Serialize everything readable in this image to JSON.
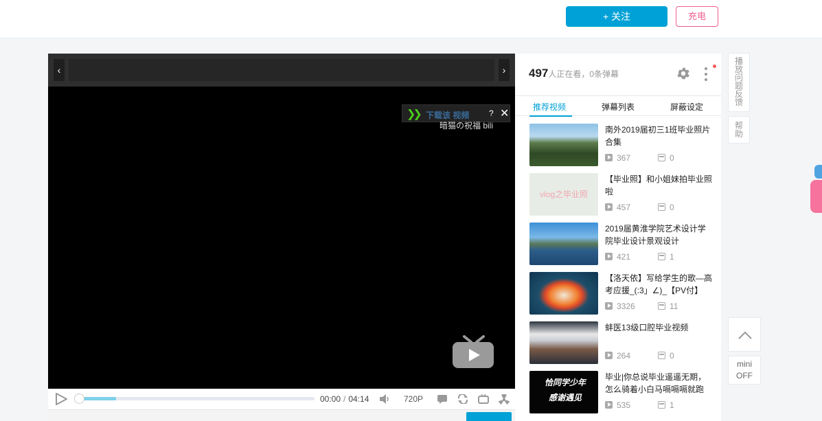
{
  "header": {
    "follow_label": "+ 关注",
    "charge_label": "充电"
  },
  "player": {
    "download_tip": "下载该 视频",
    "download_tip_help": "?",
    "download_tip_close": "✕",
    "watermark": "暗猫の祝福 bili",
    "current_time": "00:00",
    "time_separator": "/",
    "duration": "04:14",
    "quality": "720P",
    "progress_buffered": 0.16
  },
  "sidebar": {
    "viewer_count": "497",
    "viewer_text": "人正在看，0条弹幕",
    "tabs": [
      {
        "label": "推荐视频",
        "active": true
      },
      {
        "label": "弹幕列表",
        "active": false
      },
      {
        "label": "屏蔽设定",
        "active": false
      }
    ],
    "recommendations": [
      {
        "title": "南外2019届初三1班毕业照片合集",
        "plays": "367",
        "danmaku": "0"
      },
      {
        "title": "【毕业照】和小姐妹拍毕业照啦",
        "plays": "457",
        "danmaku": "0",
        "thumb_text": "vlog之毕业照"
      },
      {
        "title": "2019届黄淮学院艺术设计学院毕业设计景观设计",
        "plays": "421",
        "danmaku": "1"
      },
      {
        "title": "【洛天依】写给学生的歌—高考应援_(:3」∠)_【PV付】",
        "plays": "3326",
        "danmaku": "11"
      },
      {
        "title": "蚌医13级口腔毕业视频",
        "plays": "264",
        "danmaku": "0"
      },
      {
        "title": "毕业|你总说毕业遥遥无期，怎么骑着小白马嗝嗝嗝就跑",
        "plays": "535",
        "danmaku": "1",
        "thumb_text_1": "恰同学少年",
        "thumb_text_2": "感谢遇见"
      }
    ]
  },
  "right_rail": {
    "feedback_label": "播放问题反馈",
    "help_label": "帮助",
    "mini_label": "mini",
    "mini_state": "OFF"
  }
}
